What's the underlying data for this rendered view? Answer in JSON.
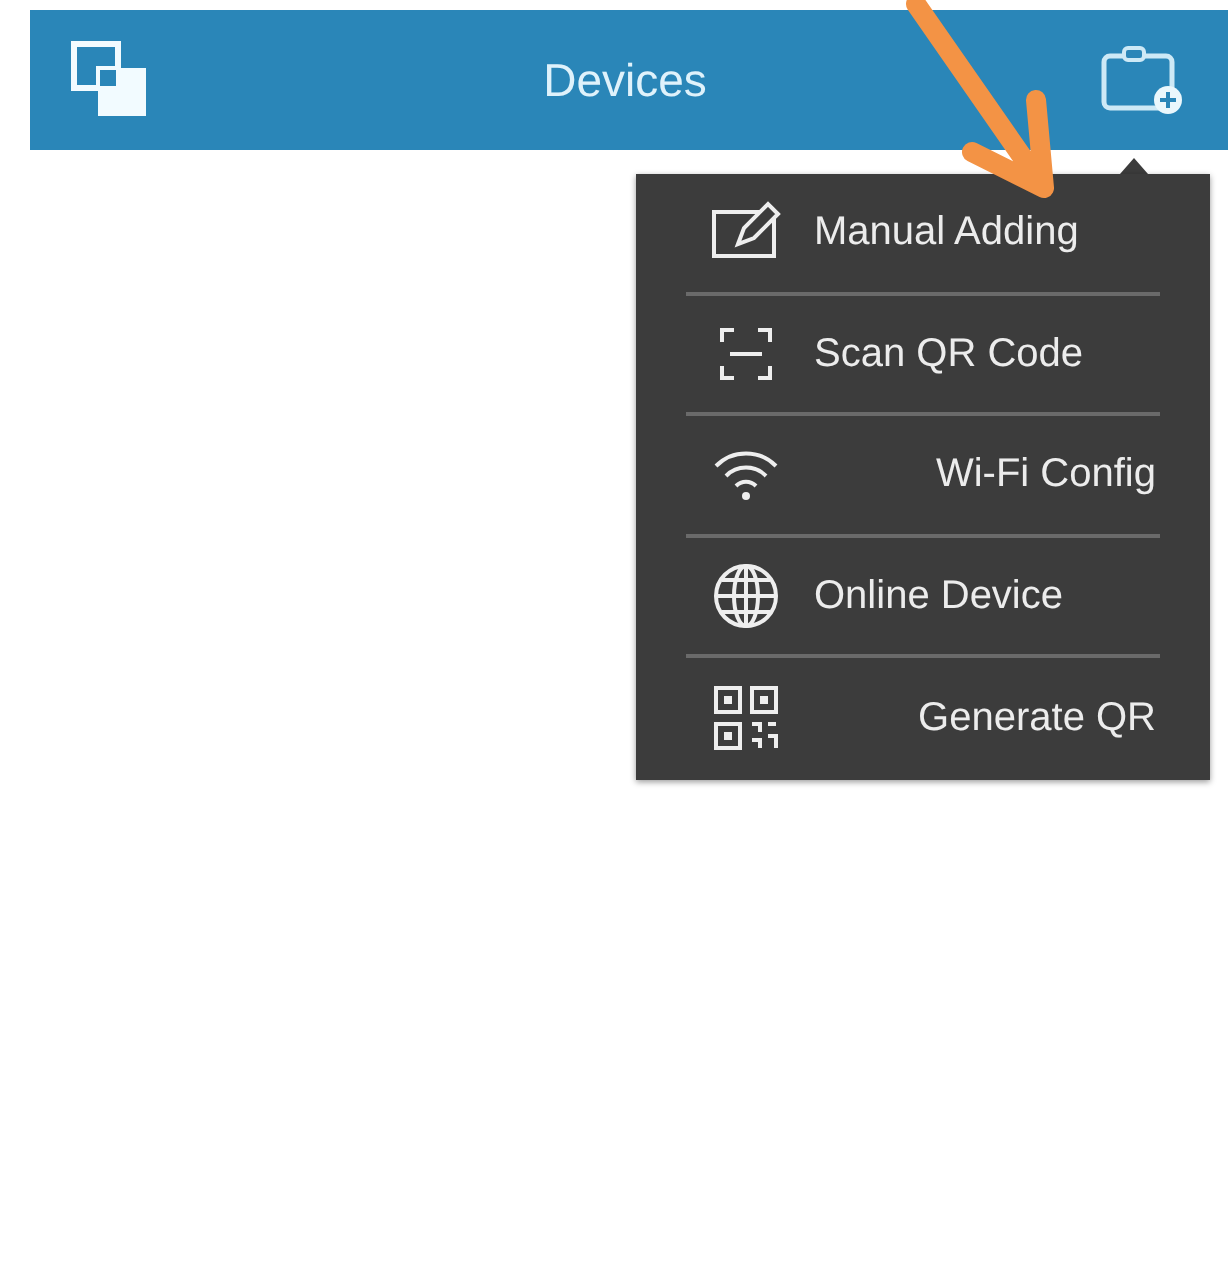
{
  "header": {
    "title": "Devices"
  },
  "menu": {
    "items": [
      {
        "kind": "edit",
        "label": "Manual Adding"
      },
      {
        "kind": "scan",
        "label": "Scan QR Code"
      },
      {
        "kind": "wifi",
        "label": "Wi-Fi Config"
      },
      {
        "kind": "globe",
        "label": "Online Device"
      },
      {
        "kind": "qr",
        "label": "Generate QR"
      }
    ]
  }
}
